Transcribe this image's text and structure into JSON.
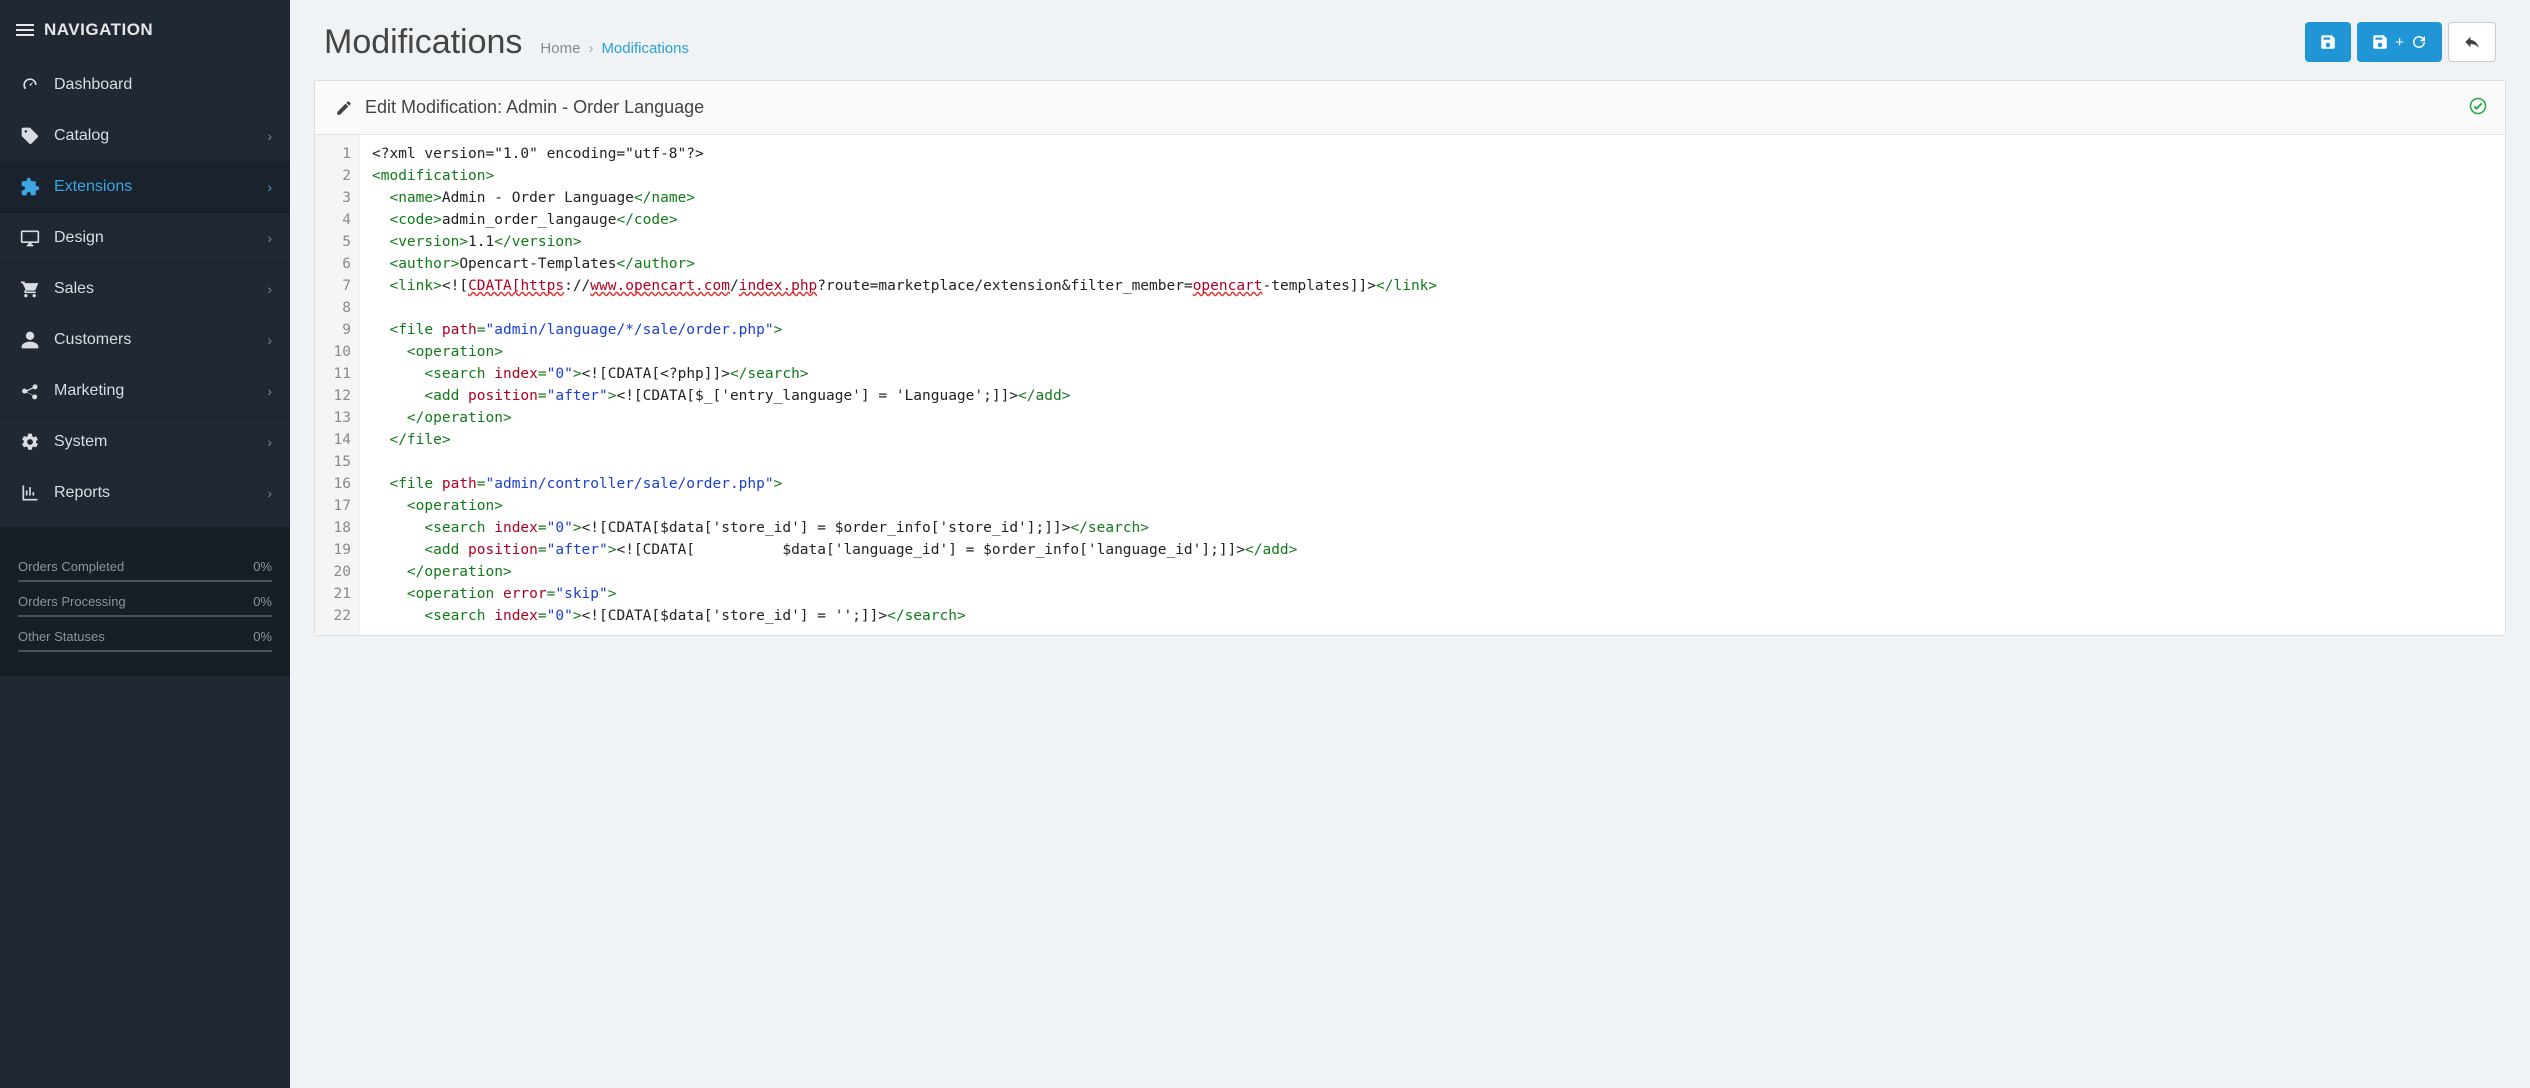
{
  "sidebar": {
    "header": "NAVIGATION",
    "items": [
      {
        "label": "Dashboard",
        "icon": "gauge-icon",
        "expandable": false
      },
      {
        "label": "Catalog",
        "icon": "tag-icon",
        "expandable": true
      },
      {
        "label": "Extensions",
        "icon": "puzzle-icon",
        "expandable": true,
        "active": true
      },
      {
        "label": "Design",
        "icon": "monitor-icon",
        "expandable": true
      },
      {
        "label": "Sales",
        "icon": "cart-icon",
        "expandable": true
      },
      {
        "label": "Customers",
        "icon": "user-icon",
        "expandable": true
      },
      {
        "label": "Marketing",
        "icon": "share-icon",
        "expandable": true
      },
      {
        "label": "System",
        "icon": "gear-icon",
        "expandable": true
      },
      {
        "label": "Reports",
        "icon": "chart-icon",
        "expandable": true
      }
    ],
    "stats": [
      {
        "label": "Orders Completed",
        "value": "0%"
      },
      {
        "label": "Orders Processing",
        "value": "0%"
      },
      {
        "label": "Other Statuses",
        "value": "0%"
      }
    ]
  },
  "header": {
    "title": "Modifications",
    "breadcrumb_home": "Home",
    "breadcrumb_current": "Modifications"
  },
  "panel": {
    "title": "Edit Modification: Admin - Order Language"
  },
  "code": {
    "lines": [
      [
        {
          "t": "text",
          "v": "<?xml version=\"1.0\" encoding=\"utf-8\"?>"
        }
      ],
      [
        {
          "t": "tag",
          "v": "<modification>"
        }
      ],
      [
        {
          "t": "text",
          "v": "  "
        },
        {
          "t": "tag",
          "v": "<name>"
        },
        {
          "t": "text",
          "v": "Admin - Order Language"
        },
        {
          "t": "tag",
          "v": "</name>"
        }
      ],
      [
        {
          "t": "text",
          "v": "  "
        },
        {
          "t": "tag",
          "v": "<code>"
        },
        {
          "t": "text",
          "v": "admin_order_langauge"
        },
        {
          "t": "tag",
          "v": "</code>"
        }
      ],
      [
        {
          "t": "text",
          "v": "  "
        },
        {
          "t": "tag",
          "v": "<version>"
        },
        {
          "t": "text",
          "v": "1.1"
        },
        {
          "t": "tag",
          "v": "</version>"
        }
      ],
      [
        {
          "t": "text",
          "v": "  "
        },
        {
          "t": "tag",
          "v": "<author>"
        },
        {
          "t": "text",
          "v": "Opencart-Templates"
        },
        {
          "t": "tag",
          "v": "</author>"
        }
      ],
      [
        {
          "t": "text",
          "v": "  "
        },
        {
          "t": "tag",
          "v": "<link>"
        },
        {
          "t": "text",
          "v": "<!["
        },
        {
          "t": "err",
          "v": "CDATA[https"
        },
        {
          "t": "text",
          "v": "://"
        },
        {
          "t": "err",
          "v": "www.opencart.com"
        },
        {
          "t": "text",
          "v": "/"
        },
        {
          "t": "err",
          "v": "index.php"
        },
        {
          "t": "text",
          "v": "?route=marketplace/extension&filter_member="
        },
        {
          "t": "err",
          "v": "opencart"
        },
        {
          "t": "text",
          "v": "-templates]]>"
        },
        {
          "t": "tag",
          "v": "</link>"
        }
      ],
      [],
      [
        {
          "t": "text",
          "v": "  "
        },
        {
          "t": "tag",
          "v": "<file"
        },
        {
          "t": "text",
          "v": " "
        },
        {
          "t": "attr",
          "v": "path"
        },
        {
          "t": "tag",
          "v": "="
        },
        {
          "t": "str",
          "v": "\"admin/language/*/sale/order.php\""
        },
        {
          "t": "tag",
          "v": ">"
        }
      ],
      [
        {
          "t": "text",
          "v": "    "
        },
        {
          "t": "tag",
          "v": "<operation>"
        }
      ],
      [
        {
          "t": "text",
          "v": "      "
        },
        {
          "t": "tag",
          "v": "<search"
        },
        {
          "t": "text",
          "v": " "
        },
        {
          "t": "attr",
          "v": "index"
        },
        {
          "t": "tag",
          "v": "="
        },
        {
          "t": "str",
          "v": "\"0\""
        },
        {
          "t": "tag",
          "v": ">"
        },
        {
          "t": "text",
          "v": "<![CDATA[<?php]]>"
        },
        {
          "t": "tag",
          "v": "</search>"
        }
      ],
      [
        {
          "t": "text",
          "v": "      "
        },
        {
          "t": "tag",
          "v": "<add"
        },
        {
          "t": "text",
          "v": " "
        },
        {
          "t": "attr",
          "v": "position"
        },
        {
          "t": "tag",
          "v": "="
        },
        {
          "t": "str",
          "v": "\"after\""
        },
        {
          "t": "tag",
          "v": ">"
        },
        {
          "t": "text",
          "v": "<![CDATA[$_['entry_language'] = 'Language';]]>"
        },
        {
          "t": "tag",
          "v": "</add>"
        }
      ],
      [
        {
          "t": "text",
          "v": "    "
        },
        {
          "t": "tag",
          "v": "</operation>"
        }
      ],
      [
        {
          "t": "text",
          "v": "  "
        },
        {
          "t": "tag",
          "v": "</file>"
        }
      ],
      [],
      [
        {
          "t": "text",
          "v": "  "
        },
        {
          "t": "tag",
          "v": "<file"
        },
        {
          "t": "text",
          "v": " "
        },
        {
          "t": "attr",
          "v": "path"
        },
        {
          "t": "tag",
          "v": "="
        },
        {
          "t": "str",
          "v": "\"admin/controller/sale/order.php\""
        },
        {
          "t": "tag",
          "v": ">"
        }
      ],
      [
        {
          "t": "text",
          "v": "    "
        },
        {
          "t": "tag",
          "v": "<operation>"
        }
      ],
      [
        {
          "t": "text",
          "v": "      "
        },
        {
          "t": "tag",
          "v": "<search"
        },
        {
          "t": "text",
          "v": " "
        },
        {
          "t": "attr",
          "v": "index"
        },
        {
          "t": "tag",
          "v": "="
        },
        {
          "t": "str",
          "v": "\"0\""
        },
        {
          "t": "tag",
          "v": ">"
        },
        {
          "t": "text",
          "v": "<![CDATA[$data['store_id'] = $order_info['store_id'];]]>"
        },
        {
          "t": "tag",
          "v": "</search>"
        }
      ],
      [
        {
          "t": "text",
          "v": "      "
        },
        {
          "t": "tag",
          "v": "<add"
        },
        {
          "t": "text",
          "v": " "
        },
        {
          "t": "attr",
          "v": "position"
        },
        {
          "t": "tag",
          "v": "="
        },
        {
          "t": "str",
          "v": "\"after\""
        },
        {
          "t": "tag",
          "v": ">"
        },
        {
          "t": "text",
          "v": "<![CDATA[          $data['language_id'] = $order_info['language_id'];]]>"
        },
        {
          "t": "tag",
          "v": "</add>"
        }
      ],
      [
        {
          "t": "text",
          "v": "    "
        },
        {
          "t": "tag",
          "v": "</operation>"
        }
      ],
      [
        {
          "t": "text",
          "v": "    "
        },
        {
          "t": "tag",
          "v": "<operation"
        },
        {
          "t": "text",
          "v": " "
        },
        {
          "t": "attr",
          "v": "error"
        },
        {
          "t": "tag",
          "v": "="
        },
        {
          "t": "str",
          "v": "\"skip\""
        },
        {
          "t": "tag",
          "v": ">"
        }
      ],
      [
        {
          "t": "text",
          "v": "      "
        },
        {
          "t": "tag",
          "v": "<search"
        },
        {
          "t": "text",
          "v": " "
        },
        {
          "t": "attr",
          "v": "index"
        },
        {
          "t": "tag",
          "v": "="
        },
        {
          "t": "str",
          "v": "\"0\""
        },
        {
          "t": "tag",
          "v": ">"
        },
        {
          "t": "text",
          "v": "<![CDATA[$data['store_id'] = '';]]>"
        },
        {
          "t": "tag",
          "v": "</search>"
        }
      ]
    ]
  }
}
